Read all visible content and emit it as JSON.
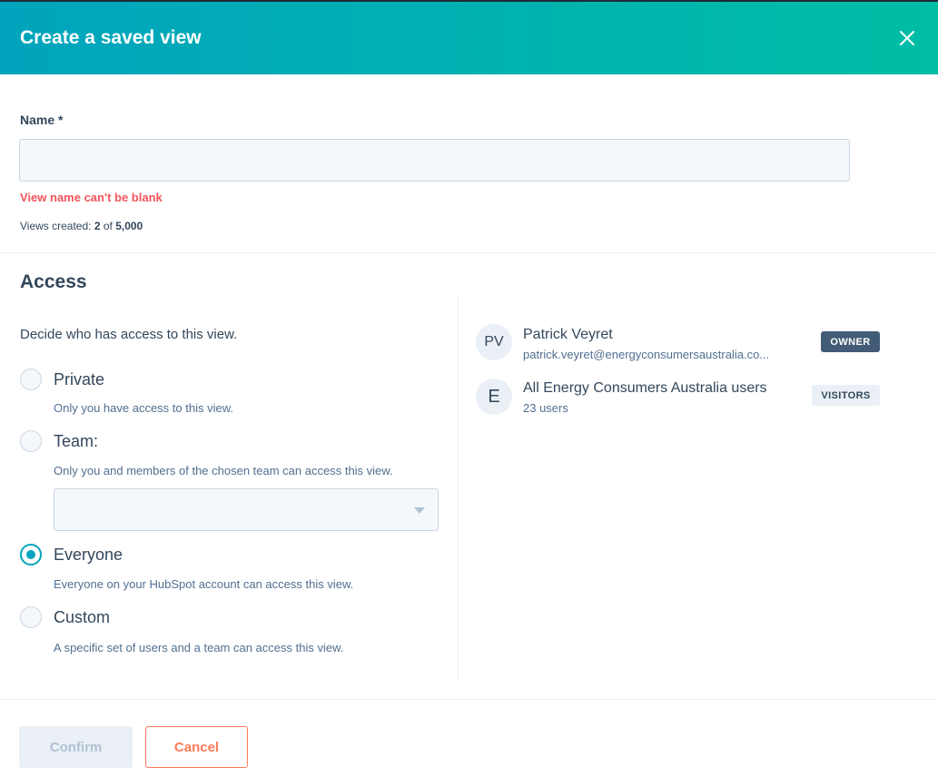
{
  "modal": {
    "title": "Create a saved view",
    "close_icon": "close-icon"
  },
  "name_field": {
    "label": "Name *",
    "value": "",
    "placeholder": "",
    "error": "View name can't be blank"
  },
  "views_created": {
    "prefix": "Views created: ",
    "count": "2",
    "of": " of ",
    "limit": "5,000"
  },
  "access": {
    "heading": "Access",
    "description": "Decide who has access to this view.",
    "options": [
      {
        "label": "Private",
        "help": "Only you have access to this view.",
        "checked": false
      },
      {
        "label": "Team:",
        "help": "Only you and members of the chosen team can access this view.",
        "checked": false
      },
      {
        "label": "Everyone",
        "help": "Everyone on your HubSpot account can access this view.",
        "checked": true
      },
      {
        "label": "Custom",
        "help": "A specific set of users and a team can access this view.",
        "checked": false
      }
    ],
    "team_select_value": ""
  },
  "members": [
    {
      "initials": "PV",
      "name": "Patrick Veyret",
      "sub": "patrick.veyret@energyconsumersaustralia.co...",
      "badge": "OWNER"
    },
    {
      "initials": "E",
      "name": "All Energy Consumers Australia users",
      "sub": "23 users",
      "badge": "VISITORS"
    }
  ],
  "footer": {
    "confirm_label": "Confirm",
    "cancel_label": "Cancel"
  },
  "colors": {
    "header_start": "#00a4bd",
    "header_end": "#00bda5",
    "error": "#f2545b",
    "accent": "#00a4bd",
    "cancel": "#ff7a59"
  }
}
